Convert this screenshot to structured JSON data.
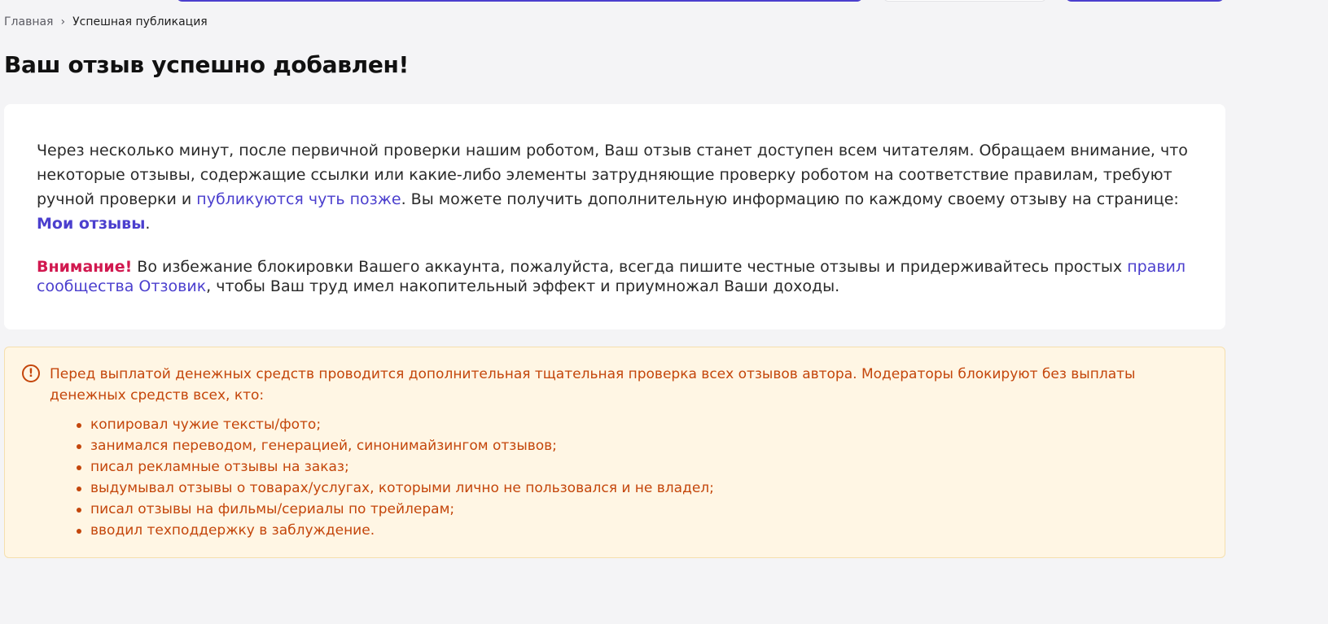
{
  "breadcrumb": {
    "home": "Главная",
    "separator": "›",
    "current": "Успешная публикация"
  },
  "title": "Ваш отзыв успешно добавлен!",
  "success": {
    "p1_a": "Через несколько минут, после первичной проверки нашим роботом, Ваш отзыв станет доступен всем читателям. Обращаем внимание, что некоторые отзывы, содержащие ссылки или какие-либо элементы затрудняющие проверку роботом на соответствие правилам, требуют ручной проверки и ",
    "p1_link": "публикуются чуть позже",
    "p1_b": ". Вы можете получить дополнительную информацию по каждому своему отзыву на странице: ",
    "my_reviews_link": "Мои отзывы",
    "p1_end": ".",
    "warning_label": "Внимание!",
    "p2_a": " Во избежание блокировки Вашего аккаунта, пожалуйста, всегда пишите честные отзывы и придерживайтесь простых ",
    "rules_link": "правил сообщества Отзовик",
    "p2_b": ", чтобы Ваш труд имел накопительный эффект и приумножал Ваши доходы."
  },
  "notice": {
    "icon": "exclamation-circle-icon",
    "text": "Перед выплатой денежных средств проводится дополнительная тщательная проверка всех отзывов автора. Модераторы блокируют без выплаты денежных средств всех, кто:",
    "items": [
      "копировал чужие тексты/фото;",
      "занимался переводом, генерацией, синонимайзингом отзывов;",
      "писал рекламные отзывы на заказ;",
      "выдумывал отзывы о товарах/услугах, которыми лично не пользовался и не владел;",
      "писал отзывы на фильмы/сериалы по трейлерам;",
      "вводил техподдержку в заблуждение."
    ]
  },
  "colors": {
    "accent": "#4b3fce",
    "warning": "#d1184f",
    "notice_text": "#c4460b",
    "notice_bg": "#fff6e4",
    "page_bg": "#f4f4f6"
  }
}
